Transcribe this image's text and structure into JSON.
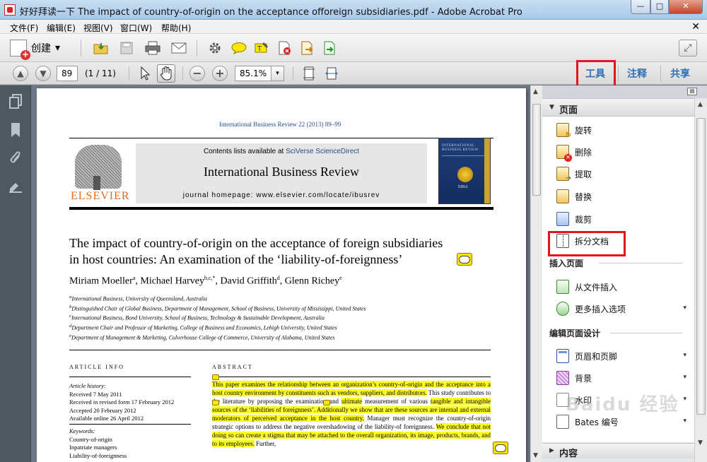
{
  "window": {
    "title": "好好拜读一下 The impact of country-of-origin on the acceptance offoreign subsidiaries.pdf - Adobe Acrobat Pro",
    "minimize": "—",
    "maximize": "□",
    "close": "✕"
  },
  "menu": {
    "items": [
      "文件(F)",
      "编辑(E)",
      "视图(V)",
      "窗口(W)",
      "帮助(H)"
    ],
    "close": "✕"
  },
  "toolbar": {
    "create_label": "创建",
    "create_dropdown": "▾"
  },
  "nav": {
    "page_number": "89",
    "page_count": "(1 / 11)",
    "zoom": "85.1%",
    "zoom_dropdown": "▾"
  },
  "task_tabs": {
    "tools": "工具",
    "comment": "注释",
    "share": "共享"
  },
  "document": {
    "journal_ref": "International Business Review 22 (2013) 89–99",
    "publisher_logo": "ELSEVIER",
    "contents_prefix": "Contents lists available at ",
    "contents_link": "SciVerse ScienceDirect",
    "journal_title": "International Business Review",
    "journal_homepage": "journal homepage: www.elsevier.com/locate/ibusrev",
    "cover_title": "INTERNATIONAL BUSINESS REVIEW",
    "cover_logo": "EIBA",
    "paper_title_line1": "The impact of country-of-origin on the acceptance of foreign subsidiaries",
    "paper_title_line2": "in host countries: An examination of the ‘liability-of-foreignness’",
    "authors": [
      {
        "name": "Miriam Moeller",
        "sup": "a",
        "sep": ", "
      },
      {
        "name": "Michael Harvey",
        "sup": "b,c,*",
        "sep": ", "
      },
      {
        "name": "David Griffith",
        "sup": "d",
        "sep": ", "
      },
      {
        "name": "Glenn Richey",
        "sup": "e",
        "sep": ""
      }
    ],
    "affiliations": [
      {
        "sup": "a",
        "text": "International Business, University of Queensland, Australia"
      },
      {
        "sup": "b",
        "text": "Distinguished Chair of Global Business, Department of Management, School of Business, University of Mississippi, United States"
      },
      {
        "sup": "c",
        "text": "International Business, Bond University, School of Business, Technology & Sustainable Development, Australia"
      },
      {
        "sup": "d",
        "text": "Department Chair and Professor of Marketing, College of Business and Economics, Lehigh University, United States"
      },
      {
        "sup": "e",
        "text": "Department of Management & Marketing, Culverhouse College of Commerce, University of Alabama, United States"
      }
    ],
    "article_info_head": "ARTICLE INFO",
    "abstract_head": "ABSTRACT",
    "article_history_label": "Article history:",
    "history": [
      "Received 7 May 2011",
      "Received in revised form 17 February 2012",
      "Accepted 20 February 2012",
      "Available online 26 April 2012"
    ],
    "keywords_label": "Keywords:",
    "keywords": [
      "Country-of-origin",
      "Inpatriate managers",
      "Liability-of-foreignness"
    ],
    "abstract_parts": [
      {
        "text": "This paper examines the relationship between an organization’s country-of-origin and the acceptance into a host country environment by constituents such as vendors, suppliers, and distributors.",
        "hl": true
      },
      {
        "text": " This study contributes to the literature by proposing the examination and ",
        "hl": false
      },
      {
        "text": "ultimate",
        "hl": true
      },
      {
        "text": " measurement of various ",
        "hl": false
      },
      {
        "text": "tangible and intangible sources of the ‘liabilities of foreignness’. Additionally we show that are these sources are internal and external moderators of perceived acceptance in the host country.",
        "hl": true
      },
      {
        "text": " Manager must recognize the country-of-origin strategic options to address the negative overshadowing of the liability-of foreignness. ",
        "hl": false
      },
      {
        "text": "We conclude that not doing so can create a stigma that may be attached to the overall organization, its image, products, brands, and to its employees.",
        "hl": true
      },
      {
        "text": " Further,",
        "hl": false
      }
    ]
  },
  "right_panel": {
    "pages_section": "页面",
    "page_items": [
      "旋转",
      "删除",
      "提取",
      "替换",
      "裁剪",
      "拆分文档"
    ],
    "insert_section": "插入页面",
    "insert_items": [
      "从文件插入",
      "更多插入选项"
    ],
    "edit_section": "编辑页面设计",
    "edit_items": [
      "页眉和页脚",
      "背景",
      "水印",
      "Bates 编号"
    ],
    "content_section": "内容",
    "expanded_arrow": "▼",
    "collapsed_arrow": "▶",
    "dropdown": "▾"
  },
  "watermark": "Baidu 经验",
  "colors": {
    "highlight_box": "#e0171f",
    "task_tab_text": "#2f6fb4",
    "text_highlight": "#ffff22",
    "elsevier_orange": "#e06a16"
  }
}
